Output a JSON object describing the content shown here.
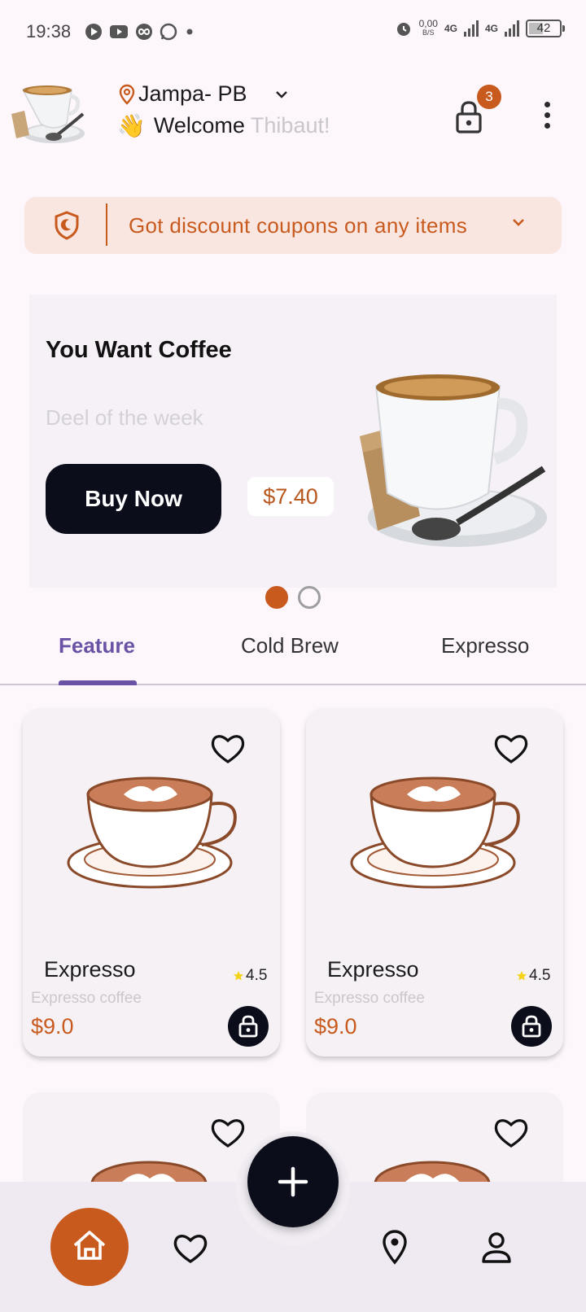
{
  "status_bar": {
    "time": "19:38",
    "net_speed_value": "0,00",
    "net_speed_unit": "B/S",
    "network_1": "4G",
    "network_2": "4G",
    "battery": "42"
  },
  "header": {
    "location": "Jampa- PB",
    "welcome_emoji": "👋",
    "welcome_text": "Welcome",
    "user_name": "Thibaut!",
    "cart_count": "3"
  },
  "coupon": {
    "text": "Got discount coupons on any items"
  },
  "promo": {
    "title": "You Want Coffee",
    "subtitle": "Deel of the week",
    "button_label": "Buy Now",
    "price": "$7.40",
    "slides_total": 2,
    "active_slide": 1
  },
  "tabs": [
    {
      "label": "Feature",
      "active": true
    },
    {
      "label": "Cold Brew",
      "active": false
    },
    {
      "label": "Expresso",
      "active": false
    }
  ],
  "products": [
    {
      "name": "Expresso",
      "description": "Expresso coffee",
      "price": "$9.0",
      "rating": "4.5"
    },
    {
      "name": "Expresso",
      "description": "Expresso coffee",
      "price": "$9.0",
      "rating": "4.5"
    }
  ],
  "colors": {
    "accent": "#c85a1e",
    "dark": "#0b0e1a",
    "tab_active": "#6a52a5",
    "background": "#fdf7fc"
  },
  "icons": {
    "location": "location-pin-icon",
    "cart": "lock-bag-icon",
    "coupon": "shield-icon",
    "favorite": "heart-icon",
    "fab": "plus-icon",
    "nav": [
      "home-icon",
      "heart-icon",
      "location-pin-icon",
      "user-icon"
    ]
  }
}
